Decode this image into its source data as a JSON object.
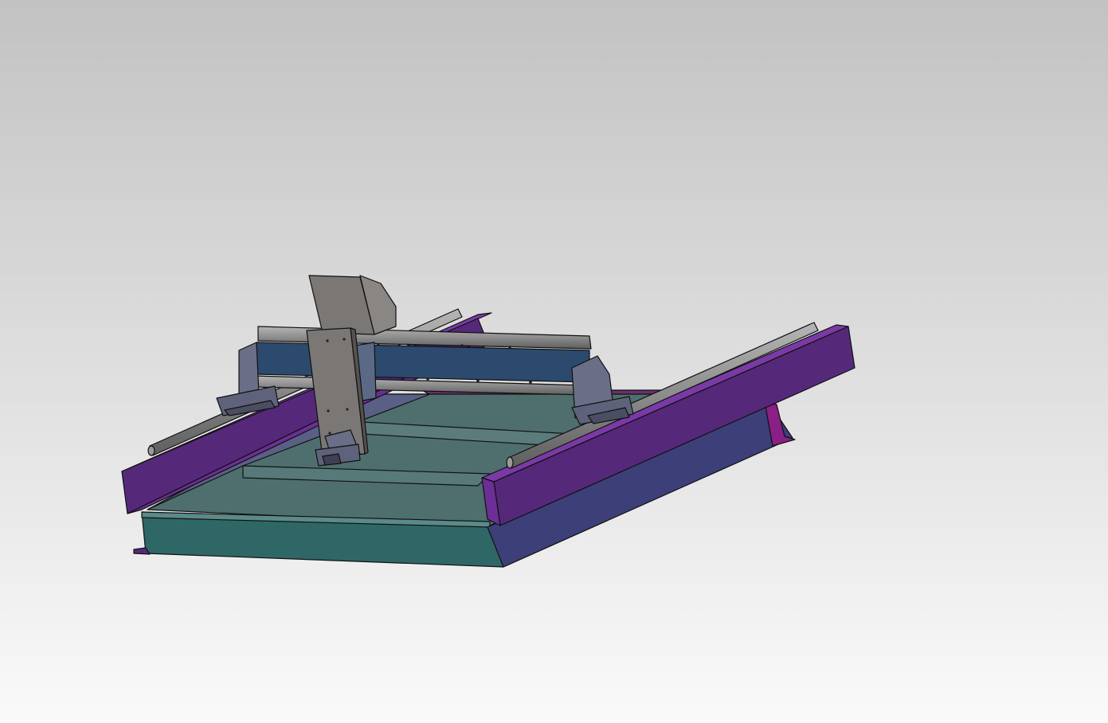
{
  "scene": {
    "background_top": "#c2c2c2",
    "background_bottom": "#fafafa",
    "colors": {
      "frame_purple": "#56287a",
      "frame_purple_light": "#6b2f95",
      "frame_magenta": "#8a1f86",
      "beam_indigo": "#3c3f78",
      "bed_teal": "#2f6766",
      "bed_teal_light": "#4e6f6e",
      "rail_gray": "#8c8c8c",
      "plate_gray": "#7b7774",
      "bracket_slate": "#6a6e86",
      "gantry_blue": "#2c4a6e",
      "outline": "#111111"
    }
  }
}
